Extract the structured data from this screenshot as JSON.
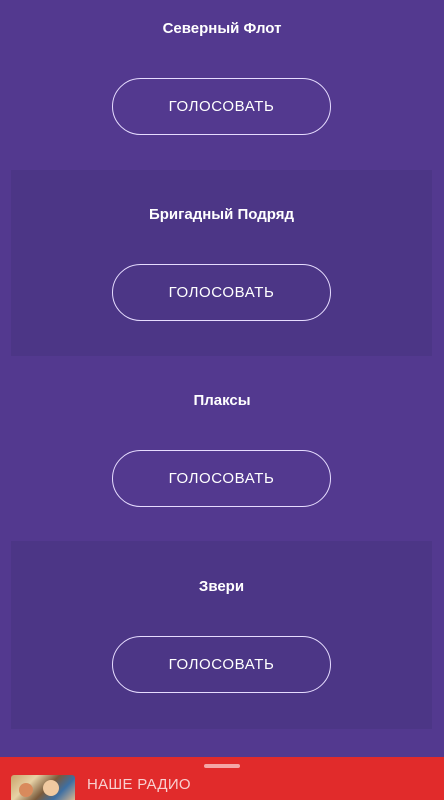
{
  "vote_button_label": "ГОЛОСОВАТЬ",
  "candidates": [
    {
      "name": "Северный Флот"
    },
    {
      "name": "Бригадный Подряд"
    },
    {
      "name": "Плаксы"
    },
    {
      "name": "Звери"
    }
  ],
  "player": {
    "station_name": "НАШЕ РАДИО",
    "cover_icon": "album-cover-thumbnail",
    "handle_icon": "drag-handle-icon"
  },
  "colors": {
    "background": "#53398f",
    "shaded_card": "#4c3686",
    "player_bar": "#e12b2b",
    "button_border": "#e6dcff"
  }
}
